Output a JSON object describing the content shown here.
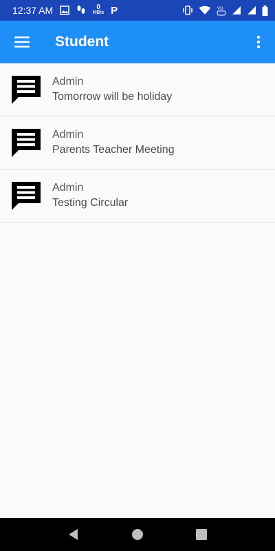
{
  "status_bar": {
    "time": "12:37 AM",
    "kbs_value": "0",
    "kbs_unit": "KB/s",
    "p_label": "P",
    "icons": [
      "image-icon",
      "footsteps-icon",
      "vibrate-icon",
      "wifi-icon",
      "volte-icon",
      "signal-icon",
      "signal-icon",
      "battery-icon"
    ]
  },
  "app_bar": {
    "title": "Student",
    "background": "#1e8ff6"
  },
  "circulars": [
    {
      "sender": "Admin",
      "message": "Tomorrow will be holiday"
    },
    {
      "sender": "Admin",
      "message": "Parents Teacher Meeting"
    },
    {
      "sender": "Admin",
      "message": "Testing Circular"
    }
  ],
  "nav": {
    "buttons": [
      "back-icon",
      "home-icon",
      "recents-icon"
    ]
  }
}
